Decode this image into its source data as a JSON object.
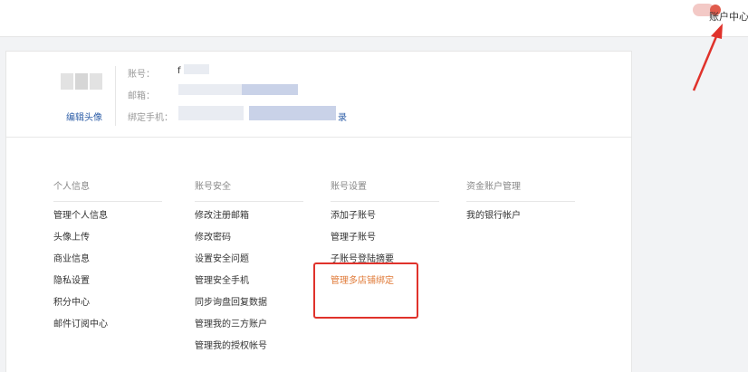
{
  "header": {
    "account_center": "账户中心"
  },
  "profile": {
    "edit_avatar": "编辑头像",
    "labels": {
      "account": "账号：",
      "email": "邮箱：",
      "phone": "绑定手机："
    },
    "account_value_partial": "f",
    "phone_value_tail": "录"
  },
  "sections": [
    {
      "title": "个人信息",
      "items": [
        "管理个人信息",
        "头像上传",
        "商业信息",
        "隐私设置",
        "积分中心",
        "邮件订阅中心"
      ]
    },
    {
      "title": "账号安全",
      "items": [
        "修改注册邮箱",
        "修改密码",
        "设置安全问题",
        "管理安全手机",
        "同步询盘回复数据",
        "管理我的三方账户",
        "管理我的授权帐号"
      ]
    },
    {
      "title": "账号设置",
      "items": [
        "添加子账号",
        "管理子账号",
        "子账号登陆摘要",
        "管理多店铺绑定"
      ]
    },
    {
      "title": "资金账户管理",
      "items": [
        "我的银行帐户"
      ]
    }
  ],
  "highlight": {
    "item": "管理多店铺绑定",
    "item_color": "#e07b39",
    "annotation_color": "#e0322b"
  }
}
